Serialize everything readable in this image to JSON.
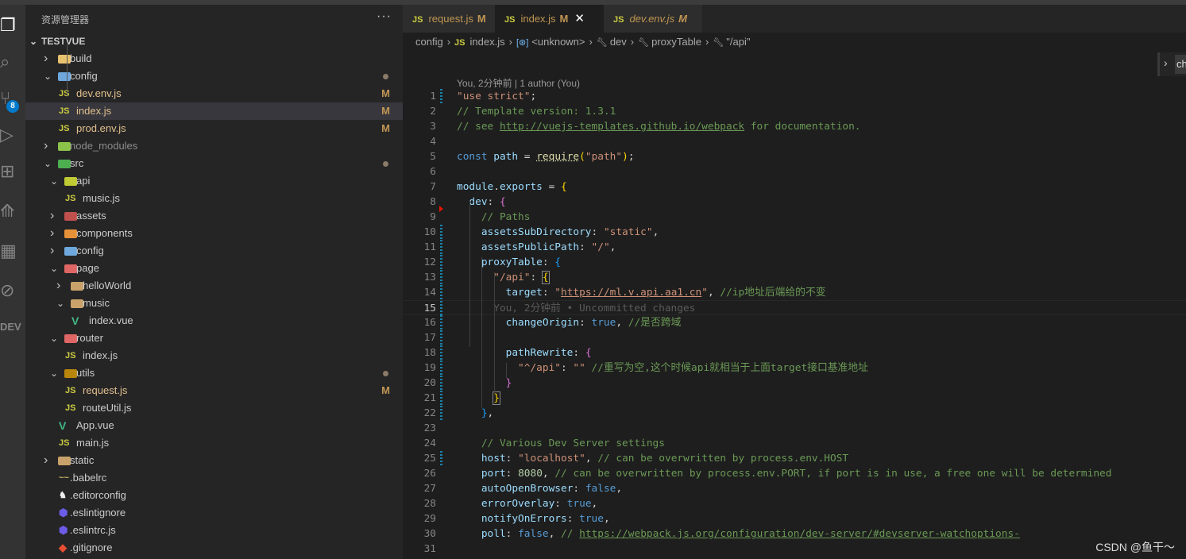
{
  "activity_bar": [
    {
      "icon": "files-icon",
      "glyph": "❐",
      "active": true
    },
    {
      "icon": "search-icon",
      "glyph": "⌕"
    },
    {
      "icon": "source-control-icon",
      "glyph": "⑂",
      "badge": "8"
    },
    {
      "icon": "run-debug-icon",
      "glyph": "▷"
    },
    {
      "icon": "extensions-icon",
      "glyph": "⊞"
    },
    {
      "icon": "chart-icon",
      "glyph": "⟰"
    },
    {
      "icon": "calendar-icon",
      "glyph": "▦"
    },
    {
      "icon": "git-graph-icon",
      "glyph": "⊘"
    },
    {
      "icon": "dev-icon",
      "glyph": "DEV"
    }
  ],
  "sidebar": {
    "title": "资源管理器",
    "more": "···",
    "root": "TESTVUE",
    "items": [
      {
        "label": "build",
        "depth": 0,
        "type": "folder",
        "open": false,
        "icon": "#e8c26e"
      },
      {
        "label": "config",
        "depth": 0,
        "type": "folder",
        "open": true,
        "icon": "#6fa8dc",
        "dot": true
      },
      {
        "label": "dev.env.js",
        "depth": 1,
        "type": "js",
        "m": "M"
      },
      {
        "label": "index.js",
        "depth": 1,
        "type": "js",
        "m": "M",
        "selected": true
      },
      {
        "label": "prod.env.js",
        "depth": 1,
        "type": "js",
        "m": "M"
      },
      {
        "label": "node_modules",
        "depth": 0,
        "type": "folder",
        "open": false,
        "icon": "#8bc34a",
        "dim": true
      },
      {
        "label": "src",
        "depth": 0,
        "type": "folder",
        "open": true,
        "icon": "#4caf50",
        "dot": true
      },
      {
        "label": "api",
        "depth": 1,
        "type": "folder",
        "open": true,
        "icon": "#c0ca33"
      },
      {
        "label": "music.js",
        "depth": 2,
        "type": "js"
      },
      {
        "label": "assets",
        "depth": 1,
        "type": "folder",
        "open": false,
        "icon": "#c0504d"
      },
      {
        "label": "components",
        "depth": 1,
        "type": "folder",
        "open": false,
        "icon": "#e69138"
      },
      {
        "label": "config",
        "depth": 1,
        "type": "folder",
        "open": false,
        "icon": "#6fa8dc"
      },
      {
        "label": "page",
        "depth": 1,
        "type": "folder",
        "open": true,
        "icon": "#e06666"
      },
      {
        "label": "helloWorld",
        "depth": 2,
        "type": "folder",
        "open": false,
        "icon": "#c8a26a"
      },
      {
        "label": "music",
        "depth": 2,
        "type": "folder",
        "open": true,
        "icon": "#c8a26a"
      },
      {
        "label": "index.vue",
        "depth": 3,
        "type": "vue"
      },
      {
        "label": "router",
        "depth": 1,
        "type": "folder",
        "open": true,
        "icon": "#e06666"
      },
      {
        "label": "index.js",
        "depth": 2,
        "type": "js"
      },
      {
        "label": "utils",
        "depth": 1,
        "type": "folder",
        "open": true,
        "icon": "#b8860b",
        "dot": true
      },
      {
        "label": "request.js",
        "depth": 2,
        "type": "js",
        "m": "M",
        "modified": true
      },
      {
        "label": "routeUtil.js",
        "depth": 2,
        "type": "js"
      },
      {
        "label": "App.vue",
        "depth": 1,
        "type": "vue"
      },
      {
        "label": "main.js",
        "depth": 1,
        "type": "js"
      },
      {
        "label": "static",
        "depth": 0,
        "type": "folder",
        "open": false,
        "icon": "#c8a26a"
      },
      {
        "label": ".babelrc",
        "depth": 0,
        "type": "babel"
      },
      {
        "label": ".editorconfig",
        "depth": 0,
        "type": "editorconfig"
      },
      {
        "label": ".eslintignore",
        "depth": 0,
        "type": "eslint"
      },
      {
        "label": ".eslintrc.js",
        "depth": 0,
        "type": "eslint"
      },
      {
        "label": ".gitignore",
        "depth": 0,
        "type": "git"
      }
    ]
  },
  "tabs": [
    {
      "label": "request.js",
      "status": "M"
    },
    {
      "label": "index.js",
      "status": "M",
      "active": true,
      "close": "✕"
    },
    {
      "label": "dev.env.js",
      "status": "M",
      "italic": true
    }
  ],
  "js_badge": "JS",
  "breadcrumb": [
    "config",
    "index.js",
    "<unknown>",
    "dev",
    "proxyTable",
    "\"/api\""
  ],
  "right_peek": "ch",
  "blame_header": "You, 2分钟前 | 1 author (You)",
  "colors": {
    "accent": "#007acc",
    "editor_bg": "#1e1e1e",
    "sidebar_bg": "#252526",
    "modified": "#c09553"
  },
  "code": [
    {
      "n": 1,
      "git": true,
      "tok": [
        [
          "s",
          "\"use strict\""
        ],
        [
          "t",
          ";"
        ]
      ]
    },
    {
      "n": 2,
      "tok": [
        [
          "c",
          "// Template version: 1.3.1"
        ]
      ]
    },
    {
      "n": 3,
      "tok": [
        [
          "c",
          "// see "
        ],
        [
          "cu",
          "http://vuejs-templates.github.io/webpack"
        ],
        [
          "c",
          " for documentation."
        ]
      ]
    },
    {
      "n": 4,
      "tok": []
    },
    {
      "n": 5,
      "tok": [
        [
          "k",
          "const"
        ],
        [
          "t",
          " "
        ],
        [
          "v",
          "path"
        ],
        [
          "t",
          " = "
        ],
        [
          "fu",
          "require"
        ],
        [
          "b1",
          "("
        ],
        [
          "s",
          "\"path\""
        ],
        [
          "b1",
          ")"
        ],
        [
          "t",
          ";"
        ]
      ]
    },
    {
      "n": 6,
      "tok": []
    },
    {
      "n": 7,
      "tok": [
        [
          "v",
          "module"
        ],
        [
          "t",
          "."
        ],
        [
          "v",
          "exports"
        ],
        [
          "t",
          " = "
        ],
        [
          "b1",
          "{"
        ]
      ]
    },
    {
      "n": 8,
      "tok": [
        [
          "t",
          "  "
        ],
        [
          "p",
          "dev"
        ],
        [
          "t",
          ": "
        ],
        [
          "b2",
          "{"
        ]
      ]
    },
    {
      "n": 9,
      "tok": [
        [
          "t",
          "    "
        ],
        [
          "c",
          "// Paths"
        ]
      ]
    },
    {
      "n": 10,
      "git": true,
      "tok": [
        [
          "t",
          "    "
        ],
        [
          "p",
          "assetsSubDirectory"
        ],
        [
          "t",
          ": "
        ],
        [
          "s",
          "\"static\""
        ],
        [
          "t",
          ","
        ]
      ]
    },
    {
      "n": 11,
      "git": true,
      "tok": [
        [
          "t",
          "    "
        ],
        [
          "p",
          "assetsPublicPath"
        ],
        [
          "t",
          ": "
        ],
        [
          "s",
          "\"/\""
        ],
        [
          "t",
          ","
        ]
      ]
    },
    {
      "n": 12,
      "git": true,
      "tok": [
        [
          "t",
          "    "
        ],
        [
          "p",
          "proxyTable"
        ],
        [
          "t",
          ": "
        ],
        [
          "b3",
          "{"
        ]
      ]
    },
    {
      "n": 13,
      "git": true,
      "tok": [
        [
          "t",
          "      "
        ],
        [
          "s",
          "\"/api\""
        ],
        [
          "t",
          ": "
        ],
        [
          "box",
          "{"
        ]
      ]
    },
    {
      "n": 14,
      "git": true,
      "tok": [
        [
          "t",
          "        "
        ],
        [
          "p",
          "target"
        ],
        [
          "t",
          ": "
        ],
        [
          "s",
          "\""
        ],
        [
          "su",
          "https://ml.v.api.aa1.cn"
        ],
        [
          "s",
          "\""
        ],
        [
          "t",
          ", "
        ],
        [
          "c",
          "//ip地址后端给的不变"
        ]
      ]
    },
    {
      "n": 15,
      "git": true,
      "cur": true,
      "tok": [
        [
          "t",
          "      "
        ],
        [
          "g",
          "You, 2分钟前 • Uncommitted changes"
        ]
      ]
    },
    {
      "n": 16,
      "git": true,
      "tok": [
        [
          "t",
          "        "
        ],
        [
          "p",
          "changeOrigin"
        ],
        [
          "t",
          ": "
        ],
        [
          "k",
          "true"
        ],
        [
          "t",
          ", "
        ],
        [
          "c",
          "//是否跨域"
        ]
      ]
    },
    {
      "n": 17,
      "git": true,
      "tok": []
    },
    {
      "n": 18,
      "git": true,
      "tok": [
        [
          "t",
          "        "
        ],
        [
          "p",
          "pathRewrite"
        ],
        [
          "t",
          ": "
        ],
        [
          "b2",
          "{"
        ]
      ]
    },
    {
      "n": 19,
      "git": true,
      "tok": [
        [
          "t",
          "          "
        ],
        [
          "s",
          "\"^/api\""
        ],
        [
          "t",
          ": "
        ],
        [
          "s",
          "\"\""
        ],
        [
          "t",
          " "
        ],
        [
          "c",
          "//重写为空,这个时候api就相当于上面target接口基准地址"
        ]
      ]
    },
    {
      "n": 20,
      "git": true,
      "tok": [
        [
          "t",
          "        "
        ],
        [
          "b2",
          "}"
        ]
      ]
    },
    {
      "n": 21,
      "git": true,
      "tok": [
        [
          "t",
          "      "
        ],
        [
          "box",
          "}"
        ]
      ]
    },
    {
      "n": 22,
      "git": true,
      "tok": [
        [
          "t",
          "    "
        ],
        [
          "b3",
          "}"
        ],
        [
          "t",
          ","
        ]
      ]
    },
    {
      "n": 23,
      "tok": []
    },
    {
      "n": 24,
      "tok": [
        [
          "t",
          "    "
        ],
        [
          "c",
          "// Various Dev Server settings"
        ]
      ]
    },
    {
      "n": 25,
      "git": true,
      "tok": [
        [
          "t",
          "    "
        ],
        [
          "p",
          "host"
        ],
        [
          "t",
          ": "
        ],
        [
          "s",
          "\"localhost\""
        ],
        [
          "t",
          ", "
        ],
        [
          "c",
          "// can be overwritten by process.env.HOST"
        ]
      ]
    },
    {
      "n": 26,
      "tok": [
        [
          "t",
          "    "
        ],
        [
          "p",
          "port"
        ],
        [
          "t",
          ": "
        ],
        [
          "n",
          "8080"
        ],
        [
          "t",
          ", "
        ],
        [
          "c",
          "// can be overwritten by process.env.PORT, if port is in use, a free one will be determined"
        ]
      ]
    },
    {
      "n": 27,
      "tok": [
        [
          "t",
          "    "
        ],
        [
          "p",
          "autoOpenBrowser"
        ],
        [
          "t",
          ": "
        ],
        [
          "k",
          "false"
        ],
        [
          "t",
          ","
        ]
      ]
    },
    {
      "n": 28,
      "tok": [
        [
          "t",
          "    "
        ],
        [
          "p",
          "errorOverlay"
        ],
        [
          "t",
          ": "
        ],
        [
          "k",
          "true"
        ],
        [
          "t",
          ","
        ]
      ]
    },
    {
      "n": 29,
      "tok": [
        [
          "t",
          "    "
        ],
        [
          "p",
          "notifyOnErrors"
        ],
        [
          "t",
          ": "
        ],
        [
          "k",
          "true"
        ],
        [
          "t",
          ","
        ]
      ]
    },
    {
      "n": 30,
      "tok": [
        [
          "t",
          "    "
        ],
        [
          "p",
          "poll"
        ],
        [
          "t",
          ": "
        ],
        [
          "k",
          "false"
        ],
        [
          "t",
          ", "
        ],
        [
          "c",
          "// "
        ],
        [
          "cu",
          "https://webpack.js.org/configuration/dev-server/#devserver-watchoptions-"
        ]
      ]
    },
    {
      "n": 31,
      "tok": []
    }
  ],
  "watermark": "CSDN @鱼干～"
}
